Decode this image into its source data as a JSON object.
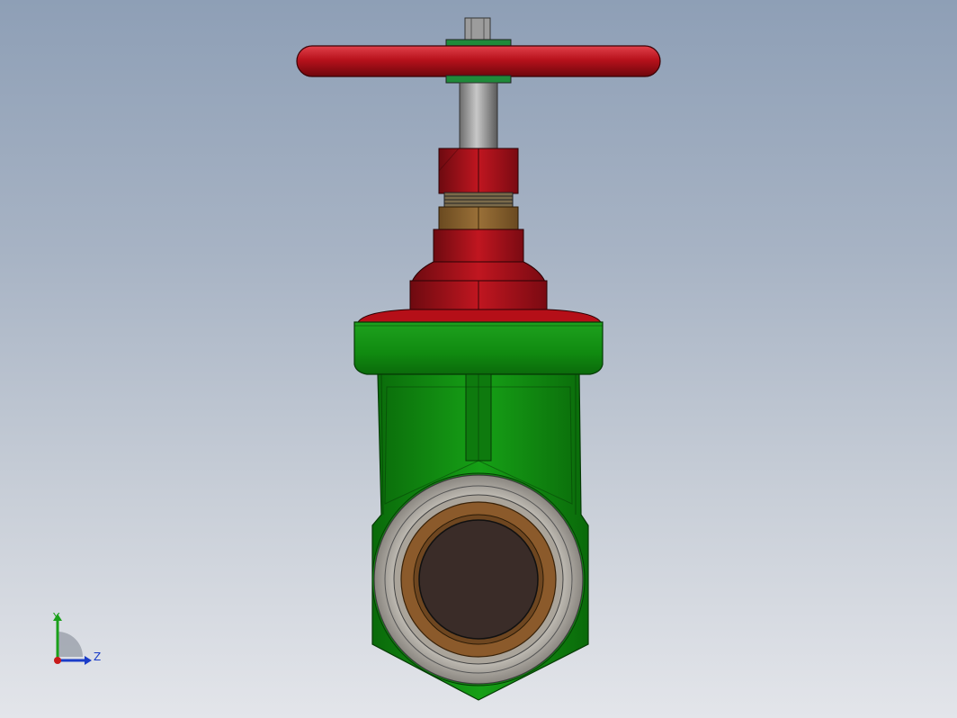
{
  "viewport": {
    "background_top": "#8e9fb6",
    "background_bottom": "#e3e5ea"
  },
  "model": {
    "handwheel_color": "#b8121c",
    "bonnet_color": "#b50f18",
    "body_color": "#128a12",
    "stem_color": "#9a9a9a",
    "packing_nut_color": "#7a5a2c",
    "port_thread_color": "#8b5a2b",
    "bore_color": "#3a2c28"
  },
  "triad": {
    "y_label": "Y",
    "z_label": "Z",
    "y_color": "#1aa01a",
    "z_color": "#1a3cc8",
    "x_color": "#c81a1a"
  }
}
